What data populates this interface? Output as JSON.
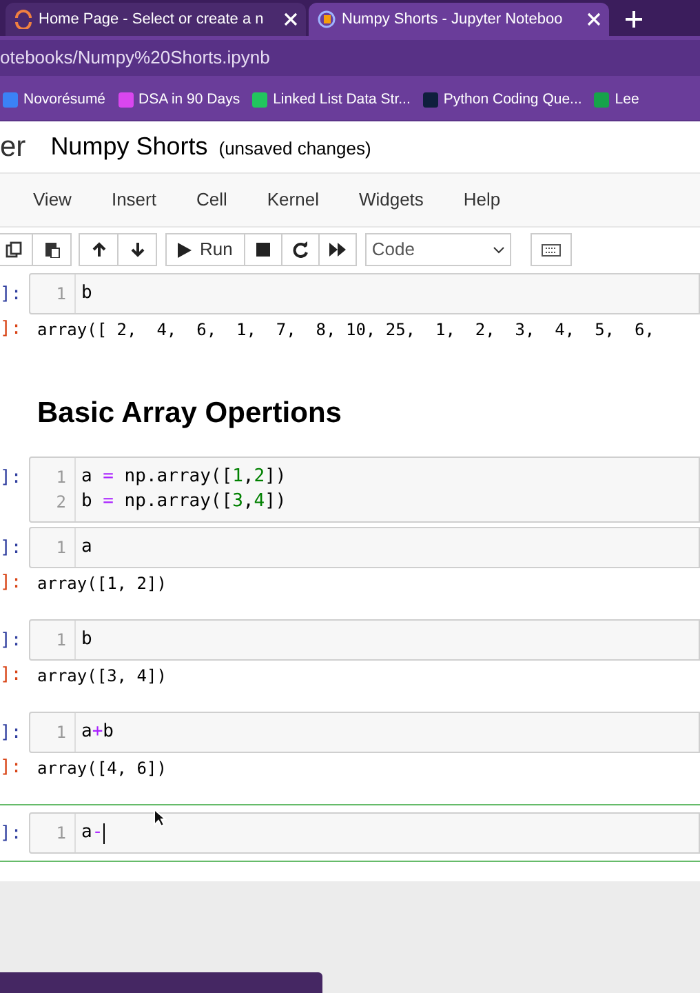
{
  "browser": {
    "tabs": [
      {
        "title": "Home Page - Select or create a n",
        "selected": false
      },
      {
        "title": "Numpy Shorts - Jupyter Noteboo",
        "selected": true
      }
    ],
    "address": "otebooks/Numpy%20Shorts.ipynb",
    "bookmarks": [
      {
        "label": "Novorésumé",
        "color": "#3b82f6"
      },
      {
        "label": "DSA in 90 Days",
        "color": "#d946ef"
      },
      {
        "label": "Linked List Data Str...",
        "color": "#22c55e"
      },
      {
        "label": "Python Coding Que...",
        "color": "#0f1f3d"
      },
      {
        "label": "Lee",
        "color": "#16a34a"
      }
    ]
  },
  "notebook": {
    "logo_text": "er",
    "title": "Numpy Shorts",
    "save_status": "(unsaved changes)",
    "menu": [
      "View",
      "Insert",
      "Cell",
      "Kernel",
      "Widgets",
      "Help"
    ],
    "run_label": "Run",
    "cell_type": "Code",
    "cells": [
      {
        "kind": "code",
        "prompt": "]:",
        "selected": false,
        "lines": [
          {
            "number": "1",
            "tokens": [
              {
                "text": "b",
                "kind": "plain"
              }
            ]
          }
        ]
      },
      {
        "kind": "output",
        "prompt": "]:",
        "text": "array([ 2,  4,  6,  1,  7,  8, 10, 25,  1,  2,  3,  4,  5,  6,"
      },
      {
        "kind": "heading",
        "text": "Basic Array Opertions"
      },
      {
        "kind": "code",
        "prompt": "]:",
        "selected": false,
        "lines": [
          {
            "number": "1",
            "tokens": [
              {
                "text": "a ",
                "kind": "plain"
              },
              {
                "text": "=",
                "kind": "op"
              },
              {
                "text": " np.array([",
                "kind": "plain"
              },
              {
                "text": "1",
                "kind": "num"
              },
              {
                "text": ",",
                "kind": "plain"
              },
              {
                "text": "2",
                "kind": "num"
              },
              {
                "text": "])",
                "kind": "plain"
              }
            ]
          },
          {
            "number": "2",
            "tokens": [
              {
                "text": "b ",
                "kind": "plain"
              },
              {
                "text": "=",
                "kind": "op"
              },
              {
                "text": " np.array([",
                "kind": "plain"
              },
              {
                "text": "3",
                "kind": "num"
              },
              {
                "text": ",",
                "kind": "plain"
              },
              {
                "text": "4",
                "kind": "num"
              },
              {
                "text": "])",
                "kind": "plain"
              }
            ]
          }
        ]
      },
      {
        "kind": "code",
        "prompt": "]:",
        "selected": false,
        "lines": [
          {
            "number": "1",
            "tokens": [
              {
                "text": "a",
                "kind": "plain"
              }
            ]
          }
        ]
      },
      {
        "kind": "output",
        "prompt": "]:",
        "text": "array([1, 2])"
      },
      {
        "kind": "code",
        "prompt": "]:",
        "selected": false,
        "lines": [
          {
            "number": "1",
            "tokens": [
              {
                "text": "b",
                "kind": "plain"
              }
            ]
          }
        ]
      },
      {
        "kind": "output",
        "prompt": "]:",
        "text": "array([3, 4])"
      },
      {
        "kind": "code",
        "prompt": "]:",
        "selected": false,
        "lines": [
          {
            "number": "1",
            "tokens": [
              {
                "text": "a",
                "kind": "plain"
              },
              {
                "text": "+",
                "kind": "op"
              },
              {
                "text": "b",
                "kind": "plain"
              }
            ]
          }
        ]
      },
      {
        "kind": "output",
        "prompt": "]:",
        "text": "array([4, 6])"
      },
      {
        "kind": "code",
        "prompt": "]:",
        "selected": true,
        "lines": [
          {
            "number": "1",
            "tokens": [
              {
                "text": "a",
                "kind": "plain"
              },
              {
                "text": "-",
                "kind": "op"
              }
            ]
          }
        ]
      }
    ]
  }
}
